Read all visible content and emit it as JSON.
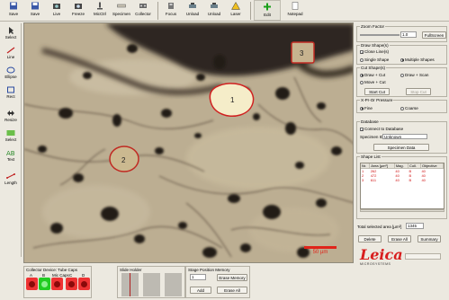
{
  "toolbar": {
    "items": [
      {
        "label": "Save",
        "icon": "save-icon"
      },
      {
        "label": "Save",
        "icon": "save-icon"
      },
      {
        "label": "Live",
        "icon": "camera-icon"
      },
      {
        "label": "Freeze",
        "icon": "camera-freeze-icon"
      },
      {
        "label": "MicCtrl",
        "icon": "microscope-icon"
      },
      {
        "label": "Specimen",
        "icon": "specimen-icon"
      },
      {
        "label": "Collector",
        "icon": "collector-icon"
      },
      {
        "label": "Focus",
        "icon": "focus-icon"
      },
      {
        "label": "Unload",
        "icon": "unload-icon"
      },
      {
        "label": "Unload",
        "icon": "unload-icon"
      },
      {
        "label": "Laser",
        "icon": "laser-warning-icon"
      },
      {
        "label": "Edit",
        "icon": "plus-icon"
      },
      {
        "label": "Notepad",
        "icon": "notepad-icon"
      }
    ]
  },
  "tools": [
    {
      "label": "Select",
      "icon": "select-arrow-icon"
    },
    {
      "label": "Line",
      "icon": "pen-line-icon"
    },
    {
      "label": "Ellipse",
      "icon": "ellipse-icon"
    },
    {
      "label": "Rect",
      "icon": "rectangle-icon"
    },
    {
      "label": "Resize",
      "icon": "resize-icon"
    },
    {
      "label": "Select",
      "icon": "select-icon"
    },
    {
      "label": "Text",
      "icon": "text-abc-icon"
    },
    {
      "label": "Length",
      "icon": "ruler-icon"
    }
  ],
  "image": {
    "scale_bar_label": "50 µm",
    "shapes": [
      "1",
      "2",
      "3"
    ]
  },
  "panel": {
    "zoom": {
      "title": "Zoom Factor",
      "value": "1.0",
      "button": "FullScreen"
    },
    "draw": {
      "title": "Draw Shape(s)",
      "close_line": "Close Line(s)",
      "single": "Single Shape",
      "multiple": "Multiple Shapes"
    },
    "cut": {
      "title": "Cut Shape(s)",
      "draw_cut": "Draw + Cut",
      "draw_scan": "Draw + Scan",
      "move_cut": "Move + Cut",
      "start_cut": "Start Cut",
      "stop_cut": "Stop Cut"
    },
    "pressure": {
      "title": "X-Pr-Or Pressure",
      "fine": "Fine",
      "coarse": "Coarse"
    },
    "database": {
      "title": "Database",
      "connect": "Connect to Database",
      "specimen_id_label": "Specimen ID",
      "specimen_id": "Unknown",
      "specimen_button": "Specimen Data"
    },
    "shape_list": {
      "title": "Shape List",
      "columns": [
        "Nr.",
        "Area [µm²]",
        "Mag.",
        "Coll.",
        "Objective"
      ],
      "rows": [
        [
          "1",
          "262",
          "40",
          "B",
          "40"
        ],
        [
          "2",
          "472",
          "40",
          "B",
          "40"
        ],
        [
          "3",
          "611",
          "40",
          "B",
          "40"
        ]
      ]
    },
    "total_label": "Total selected area [µm²]",
    "total_value": "1345",
    "buttons": {
      "delete": "Delete",
      "erase_all": "Erase All",
      "summary": "Summary"
    }
  },
  "bottom": {
    "collector_title": "Collector Device: Tube Caps",
    "slots": [
      {
        "label": "A",
        "color": "#e02020"
      },
      {
        "label": "B",
        "color": "#22c022"
      },
      {
        "label": "Mic Caps",
        "color": "#e02020"
      },
      {
        "label": "C",
        "color": "#e02020"
      },
      {
        "label": "D",
        "color": "#e02020"
      }
    ],
    "slide_title": "Slide Holder",
    "stage_title": "Stage Position Memory",
    "stage_select": "1",
    "erase_memory": "Erase Memory",
    "add": "Add",
    "erase_all": "Erase All"
  },
  "brand": {
    "name": "Leica",
    "tagline": "MICROSYSTEMS",
    "color": "#d81e1e"
  }
}
